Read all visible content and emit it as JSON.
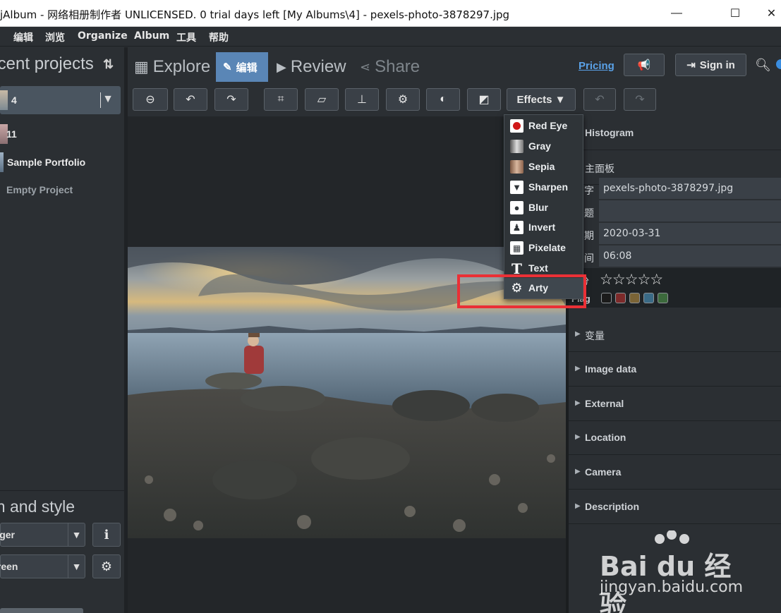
{
  "window": {
    "title": "jAlbum - 网络相册制作者 UNLICENSED. 0 trial days left [My Albums\\4] - pexels-photo-3878297.jpg",
    "minimize_glyph": "—",
    "maximize_glyph": "☐",
    "close_glyph": "✕"
  },
  "menu": [
    "编辑",
    "浏览",
    "Organize",
    "Album",
    "工具",
    "帮助"
  ],
  "left_panel": {
    "title": "Recent projects",
    "sort_glyph": "⇅",
    "projects": [
      {
        "name": "4",
        "selected": true
      },
      {
        "name": "11"
      },
      {
        "name": "Sample Portfolio"
      },
      {
        "name": "Empty Project"
      }
    ],
    "section_title": "Design and style",
    "skin_value": "Tiger",
    "style_value": "Green",
    "info_glyph": "ℹ",
    "settings_glyph": "⚙",
    "dropdown_glyph": "▼"
  },
  "tabs": {
    "explore": "Explore",
    "edit": "编辑",
    "review": "Review",
    "share": "Share"
  },
  "header": {
    "pricing": "Pricing",
    "sign_in": "Sign in"
  },
  "toolbar": {
    "effects_label": "Effects ▼"
  },
  "effects_menu": [
    {
      "label": "Red Eye",
      "icon": "red-eye-icon"
    },
    {
      "label": "Gray",
      "icon": "gray-icon"
    },
    {
      "label": "Sepia",
      "icon": "sepia-icon"
    },
    {
      "label": "Sharpen",
      "icon": "sharpen-icon"
    },
    {
      "label": "Blur",
      "icon": "blur-icon"
    },
    {
      "label": "Invert",
      "icon": "invert-icon"
    },
    {
      "label": "Pixelate",
      "icon": "pixelate-icon"
    },
    {
      "label": "Text",
      "icon": "text-icon"
    },
    {
      "label": "Arty",
      "icon": "arty-icon"
    }
  ],
  "right_panel": {
    "histogram": "Histogram",
    "main_panel": "主面板",
    "fields": [
      {
        "key": "字",
        "value": "pexels-photo-3878297.jpg"
      },
      {
        "key": "题",
        "value": ""
      },
      {
        "key": "期",
        "value": "2020-03-31"
      },
      {
        "key": "间",
        "value": "06:08"
      }
    ],
    "rating_key": "分",
    "stars": "☆☆☆☆☆",
    "flag_key": "Flag",
    "flag_colors": [
      "#1b1b1b",
      "#7d2a2a",
      "#7b6436",
      "#3a6a86",
      "#3c6a3c"
    ],
    "sections": [
      "变量",
      "Image data",
      "External",
      "Location",
      "Camera",
      "Description"
    ]
  },
  "watermark": {
    "main": "Bai du 经验",
    "sub": "jingyan.baidu.com"
  }
}
